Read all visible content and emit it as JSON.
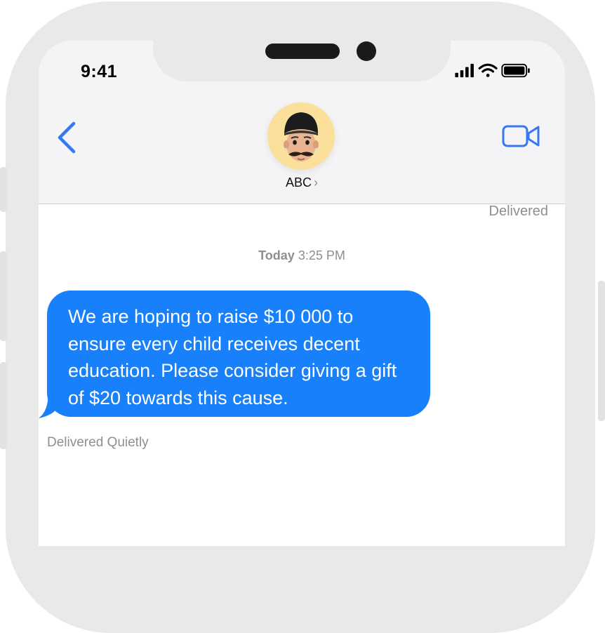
{
  "status_bar": {
    "time": "9:41",
    "signal_icon": "cellular-signal-icon",
    "wifi_icon": "wifi-icon",
    "battery_icon": "battery-icon"
  },
  "nav": {
    "back_icon": "chevron-left-icon",
    "contact_name": "ABC",
    "contact_chevron": "›",
    "video_icon": "video-camera-icon",
    "accent_color": "#3478f6"
  },
  "thread": {
    "top_status": "Delivered",
    "timestamp_day": "Today",
    "timestamp_time": "3:25 PM",
    "message": "We are hoping to raise $10 000 to ensure every child receives decent education. Please consider giving a gift of $20 towards this cause.",
    "message_status": "Delivered Quietly",
    "bubble_color": "#1880fb"
  }
}
